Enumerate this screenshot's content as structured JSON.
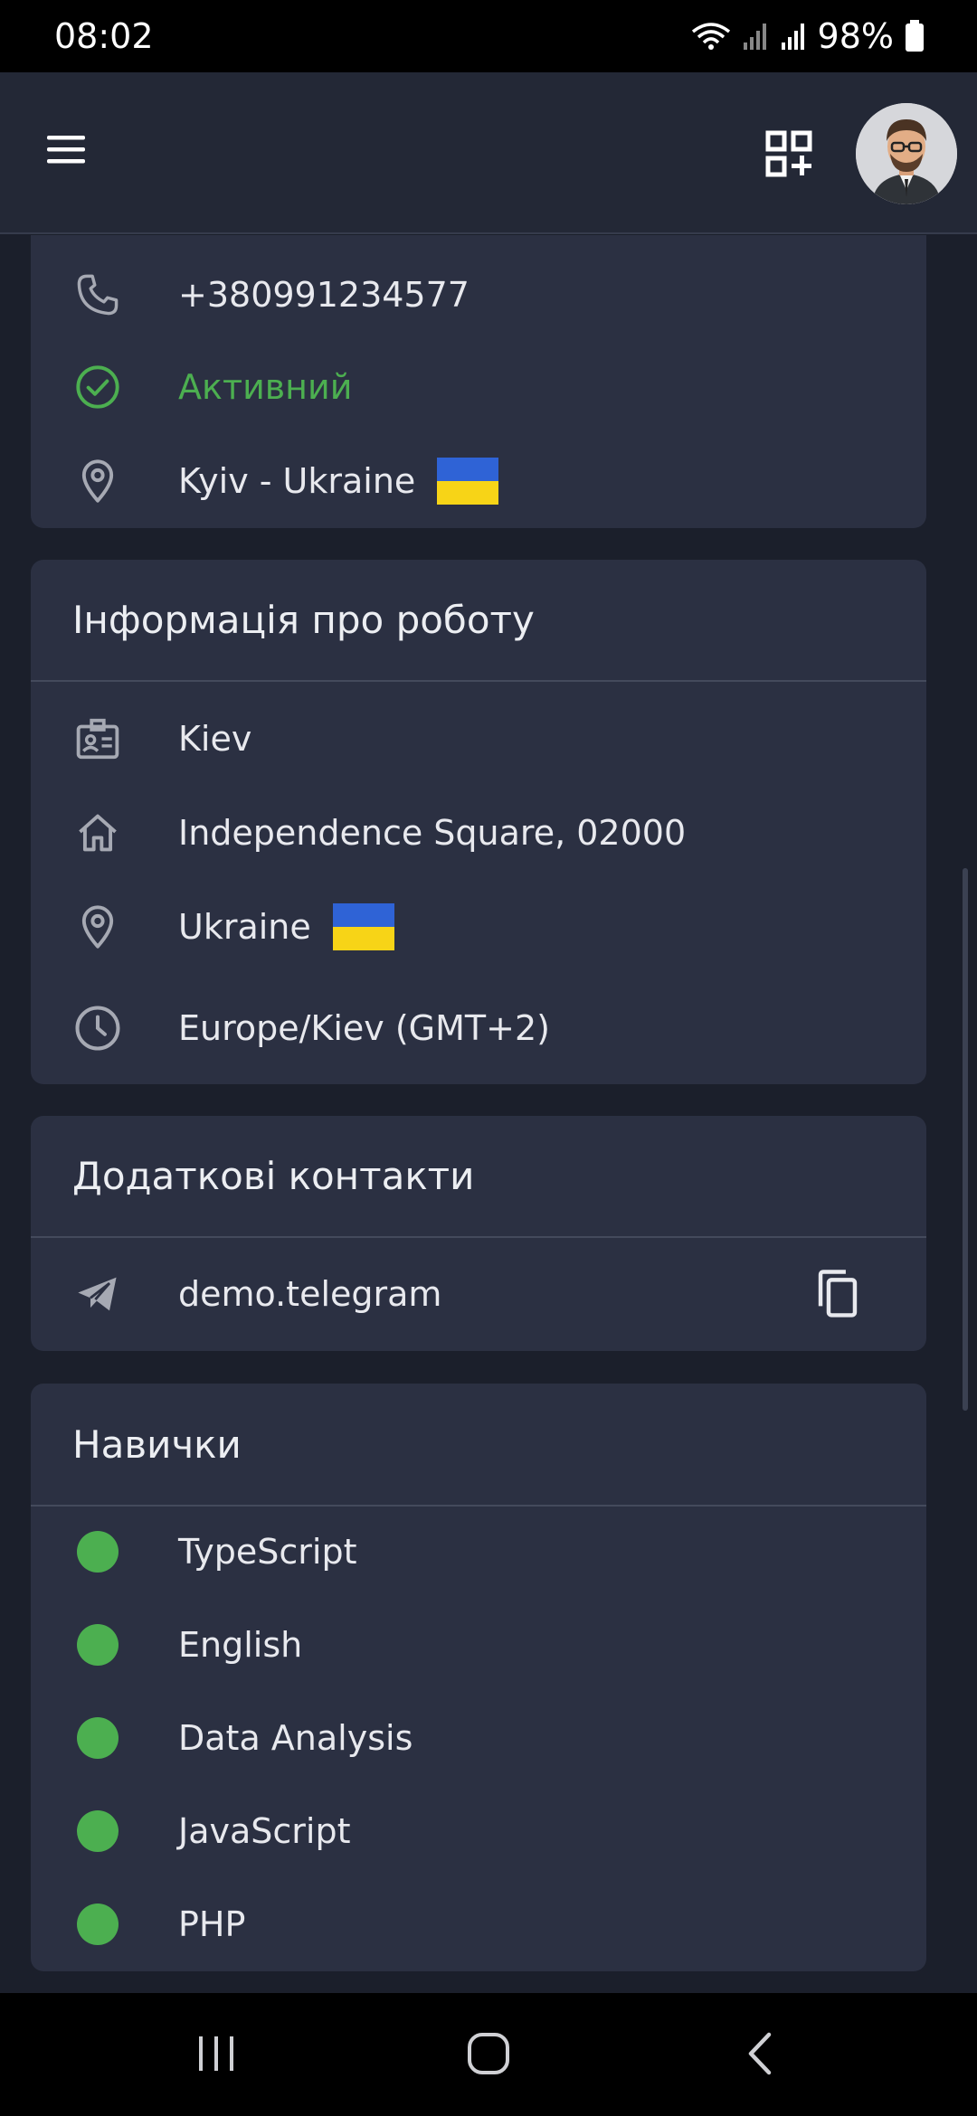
{
  "status_bar": {
    "time": "08:02",
    "battery": "98%",
    "icons": [
      "wifi-icon",
      "signal-icon",
      "signal-icon",
      "battery-icon"
    ]
  },
  "header": {
    "menu_icon": "hamburger-menu-icon",
    "qr_icon": "qr-add-icon",
    "avatar": "user-avatar"
  },
  "contact": {
    "phone": "+380991234577",
    "status": "Активний",
    "location": "Kyiv - Ukraine"
  },
  "work_info": {
    "title": "Інформація про роботу",
    "city": "Kiev",
    "address": "Independence Square, 02000",
    "country": "Ukraine",
    "timezone": "Europe/Kiev (GMT+2)"
  },
  "additional_contacts": {
    "title": "Додаткові контакти",
    "telegram": "demo.telegram"
  },
  "skills": {
    "title": "Навички",
    "items": [
      "TypeScript",
      "English",
      "Data Analysis",
      "JavaScript",
      "PHP"
    ]
  },
  "colors": {
    "background": "#1b1f2b",
    "card": "#2b3042",
    "header": "#232836",
    "active_green": "#4caf50",
    "flag_blue": "#2f63d6",
    "flag_yellow": "#f7d417"
  }
}
